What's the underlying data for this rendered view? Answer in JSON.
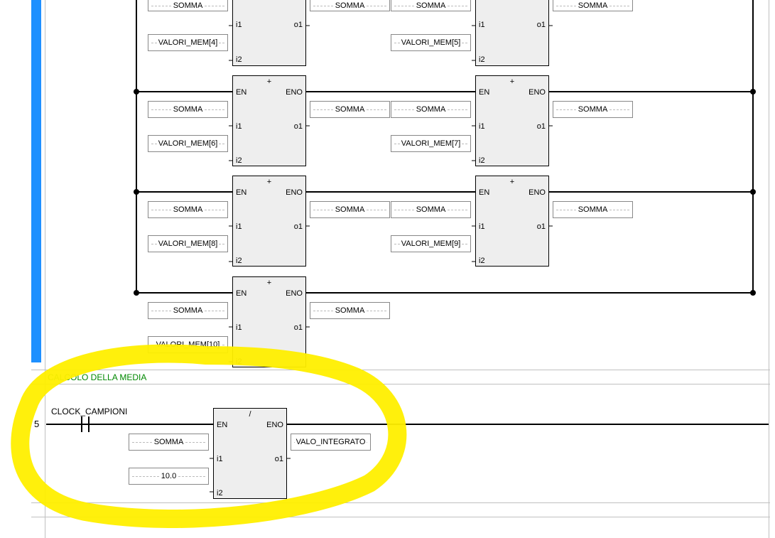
{
  "rungs": {
    "main_top": {
      "blocks": [
        {
          "op": "+",
          "inputs": [
            {
              "label": "SOMMA",
              "pin": "i1"
            },
            {
              "label": "VALORI_MEM[4]",
              "pin": "i2"
            }
          ],
          "outputs": [
            {
              "label": "SOMMA",
              "pin": "o1"
            }
          ]
        },
        {
          "op": "+",
          "inputs": [
            {
              "label": "SOMMA",
              "pin": "i1"
            },
            {
              "label": "VALORI_MEM[5]",
              "pin": "i2"
            }
          ],
          "outputs": [
            {
              "label": "SOMMA",
              "pin": "o1"
            }
          ]
        }
      ]
    },
    "row2": {
      "blocks": [
        {
          "op": "+",
          "en": "EN",
          "eno": "ENO",
          "inputs": [
            {
              "label": "SOMMA",
              "pin": "i1"
            },
            {
              "label": "VALORI_MEM[6]",
              "pin": "i2"
            }
          ],
          "outputs": [
            {
              "label": "SOMMA",
              "pin": "o1"
            }
          ]
        },
        {
          "op": "+",
          "en": "EN",
          "eno": "ENO",
          "inputs": [
            {
              "label": "SOMMA",
              "pin": "i1"
            },
            {
              "label": "VALORI_MEM[7]",
              "pin": "i2"
            }
          ],
          "outputs": [
            {
              "label": "SOMMA",
              "pin": "o1"
            }
          ]
        }
      ]
    },
    "row3": {
      "blocks": [
        {
          "op": "+",
          "en": "EN",
          "eno": "ENO",
          "inputs": [
            {
              "label": "SOMMA",
              "pin": "i1"
            },
            {
              "label": "VALORI_MEM[8]",
              "pin": "i2"
            }
          ],
          "outputs": [
            {
              "label": "SOMMA",
              "pin": "o1"
            }
          ]
        },
        {
          "op": "+",
          "en": "EN",
          "eno": "ENO",
          "inputs": [
            {
              "label": "SOMMA",
              "pin": "i1"
            },
            {
              "label": "VALORI_MEM[9]",
              "pin": "i2"
            }
          ],
          "outputs": [
            {
              "label": "SOMMA",
              "pin": "o1"
            }
          ]
        }
      ]
    },
    "row4": {
      "blocks": [
        {
          "op": "+",
          "en": "EN",
          "eno": "ENO",
          "inputs": [
            {
              "label": "SOMMA",
              "pin": "i1"
            },
            {
              "label": "VALORI_MEM[10]",
              "pin": "i2"
            }
          ],
          "outputs": [
            {
              "label": "SOMMA",
              "pin": "o1"
            }
          ]
        }
      ]
    },
    "media": {
      "number": "5",
      "comment": "CALCOLO DELLA MEDIA",
      "contact_var": "CLOCK_CAMPIONI",
      "block": {
        "op": "/",
        "en": "EN",
        "eno": "ENO",
        "inputs": [
          {
            "label": "SOMMA",
            "pin": "i1"
          },
          {
            "label": "10.0",
            "pin": "i2"
          }
        ],
        "outputs": [
          {
            "label": "VALO_INTEGRATO",
            "pin": "o1"
          }
        ]
      }
    }
  },
  "pins": {
    "en": "EN",
    "eno": "ENO",
    "i1": "i1",
    "i2": "i2",
    "o1": "o1"
  }
}
